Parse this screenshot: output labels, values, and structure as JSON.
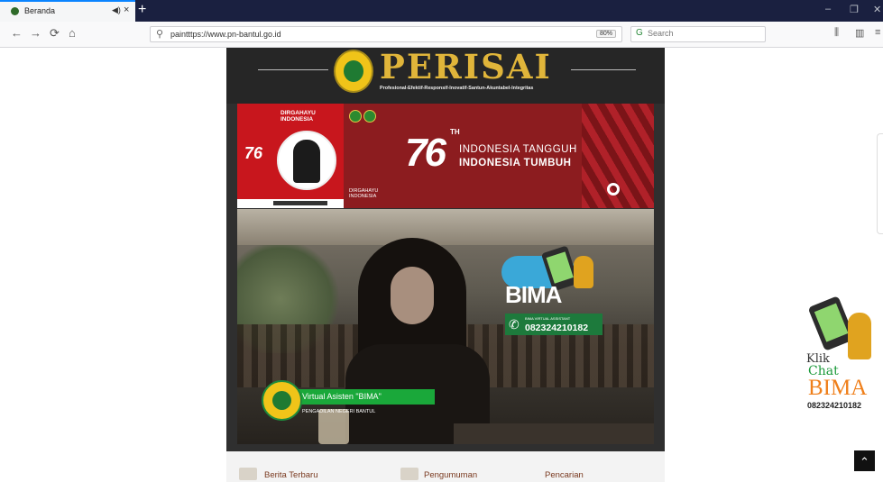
{
  "browser": {
    "tab_title": "Beranda",
    "new_tab": "+",
    "url": "paintttps://www.pn-bantul.go.id",
    "zoom": "80%",
    "search_placeholder": "Search",
    "controls": {
      "minimize": "–",
      "restore": "❐",
      "close": "✕"
    },
    "nav": {
      "back": "←",
      "forward": "→",
      "reload": "⟳",
      "home": "⌂",
      "library": "⫼",
      "sidebar": "▥",
      "menu": "≡"
    }
  },
  "site": {
    "brand": "PERISAI",
    "tagline": "Profesional-Efektif-Responsif-Inovatif-Santun-Akuntabel-Integritas"
  },
  "banner": {
    "dirgahayu": "DIRGAHAYU\nINDONESIA",
    "number_76": "76",
    "th": "TH",
    "line1": "INDONESIA TANGGUH",
    "line2": "INDONESIA TUMBUH",
    "dirgahayu_small": "DIRGAHAYU\nINDONESIA"
  },
  "hero": {
    "bima_word": "BIMA",
    "bima_caption": "BIMA VIRTUAL ASSISTANT",
    "bima_phone": "082324210182",
    "va_title": "Virtual Asisten \"BIMA\"",
    "va_subtitle": "PENGADILAN NEGERI BANTUL"
  },
  "contentbar": {
    "items": [
      "Berita Terbaru",
      "Pengumuman",
      "Pencarian"
    ]
  },
  "chat_widget": {
    "klik": "Klik",
    "chat": "Chat",
    "bima": "BIMA",
    "phone": "082324210182"
  },
  "scroll_top_icon": "chevron-up-icon",
  "colors": {
    "accent": "#0a84ff",
    "brand_gold": "#e0b53a",
    "banner_red": "#8c1c1f",
    "green": "#1aa83a",
    "bima_orange": "#ef7f1a"
  }
}
